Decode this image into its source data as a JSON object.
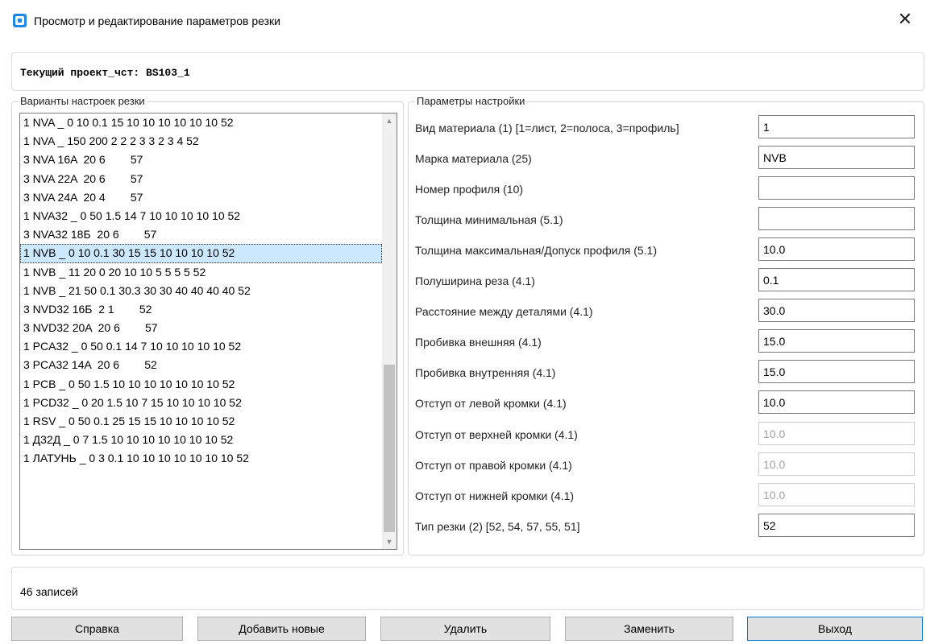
{
  "window": {
    "title": "Просмотр и редактирование параметров резки",
    "close_glyph": "✕",
    "accent_color": "#1e88e5"
  },
  "project": {
    "label": "Текущий проект_чст: BS103_1"
  },
  "variants": {
    "group_title": "Варианты настроек резки",
    "selected_index": 7,
    "items": [
      "1 NVA _ 0 10 0.1 15 10 10 10 10 10 10 52",
      "1 NVA _ 150 200 2 2 2 3 3 2 3 4 52",
      "3 NVA 16A  20 6        57",
      "3 NVA 22A  20 6        57",
      "3 NVA 24A  20 4        57",
      "1 NVA32 _ 0 50 1.5 14 7 10 10 10 10 10 52",
      "3 NVA32 18Б  20 6        57",
      "1 NVB _ 0 10 0.1 30 15 15 10 10 10 10 52",
      "1 NVB _ 11 20 0 20 10 10 5 5 5 5 52",
      "1 NVB _ 21 50 0.1 30.3 30 30 40 40 40 40 52",
      "3 NVD32 16Б  2 1        52",
      "3 NVD32 20A  20 6        57",
      "1 PCA32 _ 0 50 0.1 14 7 10 10 10 10 10 52",
      "3 PCA32 14A  20 6        52",
      "1 PCB _ 0 50 1.5 10 10 10 10 10 10 10 52",
      "1 PCD32 _ 0 20 1.5 10 7 15 10 10 10 10 52",
      "1 RSV _ 0 50 0.1 25 15 15 10 10 10 10 52",
      "1 Д32Д _ 0 7 1.5 10 10 10 10 10 10 10 52",
      "1 ЛАТУНЬ _ 0 3 0.1 10 10 10 10 10 10 10 52"
    ],
    "scroll_up_glyph": "▲",
    "scroll_down_glyph": "▼"
  },
  "params": {
    "group_title": "Параметры настройки",
    "fields": [
      {
        "label": "Вид материала (1) [1=лист, 2=полоса, 3=профиль]",
        "value": "1",
        "disabled": false
      },
      {
        "label": "Марка материала (25)",
        "value": "NVB",
        "disabled": false
      },
      {
        "label": "Номер профиля (10)",
        "value": "",
        "disabled": false
      },
      {
        "label": "Толщина минимальная (5.1)",
        "value": "",
        "disabled": false
      },
      {
        "label": "Толщина максимальная/Допуск профиля (5.1)",
        "value": "10.0",
        "disabled": false
      },
      {
        "label": "Полуширина реза (4.1)",
        "value": "0.1",
        "disabled": false
      },
      {
        "label": "Расстояние между деталями (4.1)",
        "value": "30.0",
        "disabled": false
      },
      {
        "label": "Пробивка внешняя (4.1)",
        "value": "15.0",
        "disabled": false
      },
      {
        "label": "Пробивка внутренняя (4.1)",
        "value": "15.0",
        "disabled": false
      },
      {
        "label": "Отступ от левой кромки (4.1)",
        "value": "10.0",
        "disabled": false
      },
      {
        "label": "Отступ от верхней кромки (4.1)",
        "value": "10.0",
        "disabled": true
      },
      {
        "label": "Отступ от правой кромки (4.1)",
        "value": "10.0",
        "disabled": true
      },
      {
        "label": "Отступ от нижней кромки (4.1)",
        "value": "10.0",
        "disabled": true
      },
      {
        "label": "Тип резки (2) [52, 54, 57, 55, 51]",
        "value": "52",
        "disabled": false
      }
    ]
  },
  "status": {
    "text": "46 записей"
  },
  "buttons": {
    "help": "Справка",
    "add": "Добавить новые",
    "delete": "Удалить",
    "replace": "Заменить",
    "exit": "Выход"
  }
}
